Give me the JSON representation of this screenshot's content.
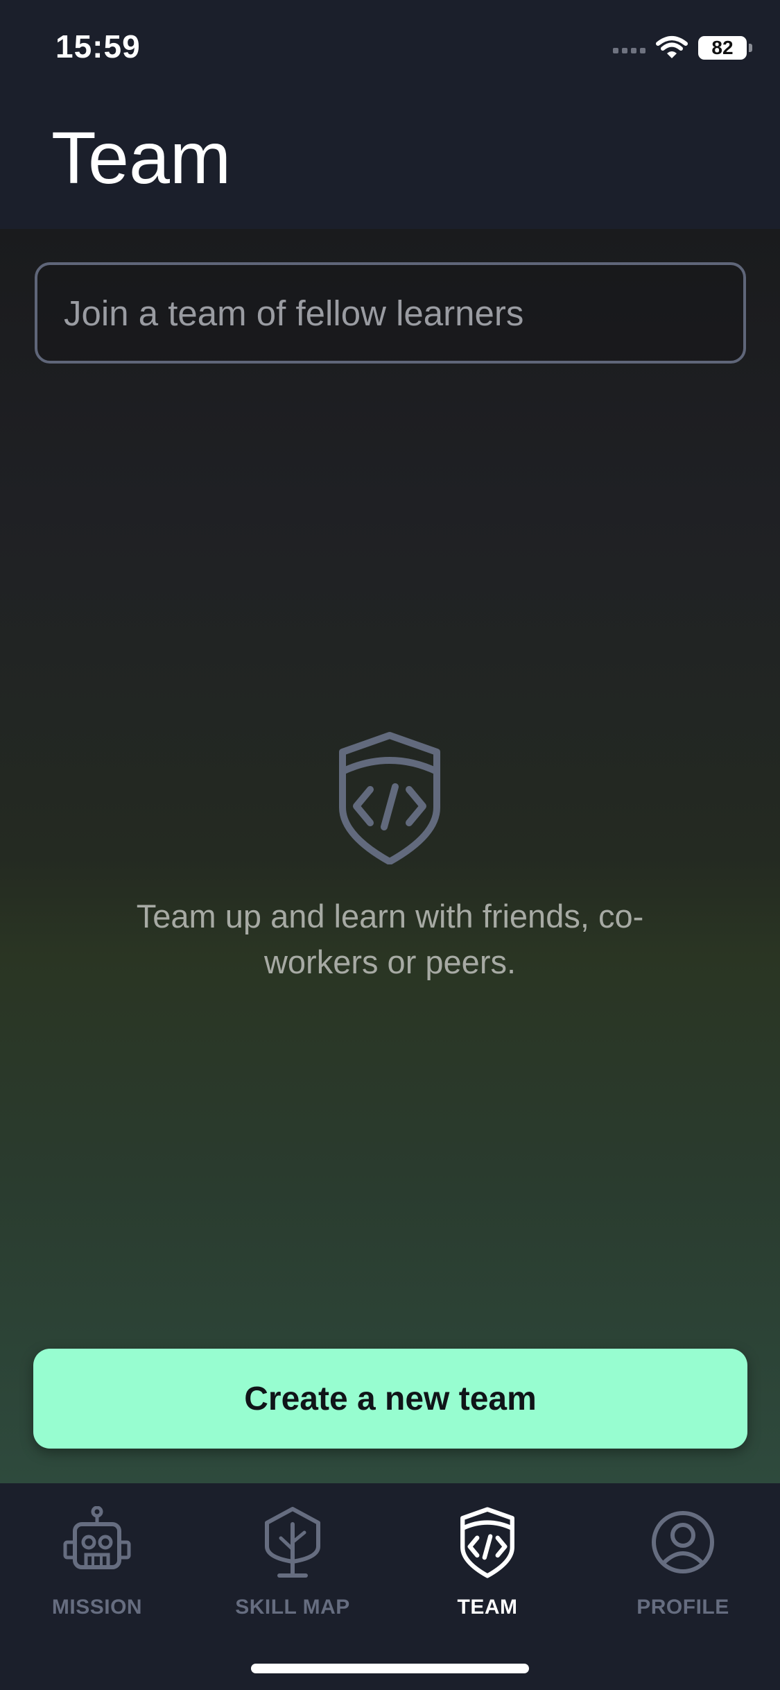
{
  "status_bar": {
    "time": "15:59",
    "battery": "82"
  },
  "header": {
    "title": "Team"
  },
  "search": {
    "placeholder": "Join a team of fellow learners"
  },
  "empty_state": {
    "icon": "team-shield-icon",
    "message": "Team up and learn with friends, co-workers or peers."
  },
  "actions": {
    "create_label": "Create a new team"
  },
  "tabs": [
    {
      "label": "MISSION",
      "icon": "robot-icon",
      "active": false
    },
    {
      "label": "SKILL MAP",
      "icon": "tree-icon",
      "active": false
    },
    {
      "label": "TEAM",
      "icon": "team-shield-icon",
      "active": true
    },
    {
      "label": "PROFILE",
      "icon": "profile-icon",
      "active": false
    }
  ],
  "colors": {
    "accent": "#97fdd0",
    "background": "#1b1f2b",
    "inactive_tab": "#666d80",
    "active_tab": "#ffffff"
  }
}
